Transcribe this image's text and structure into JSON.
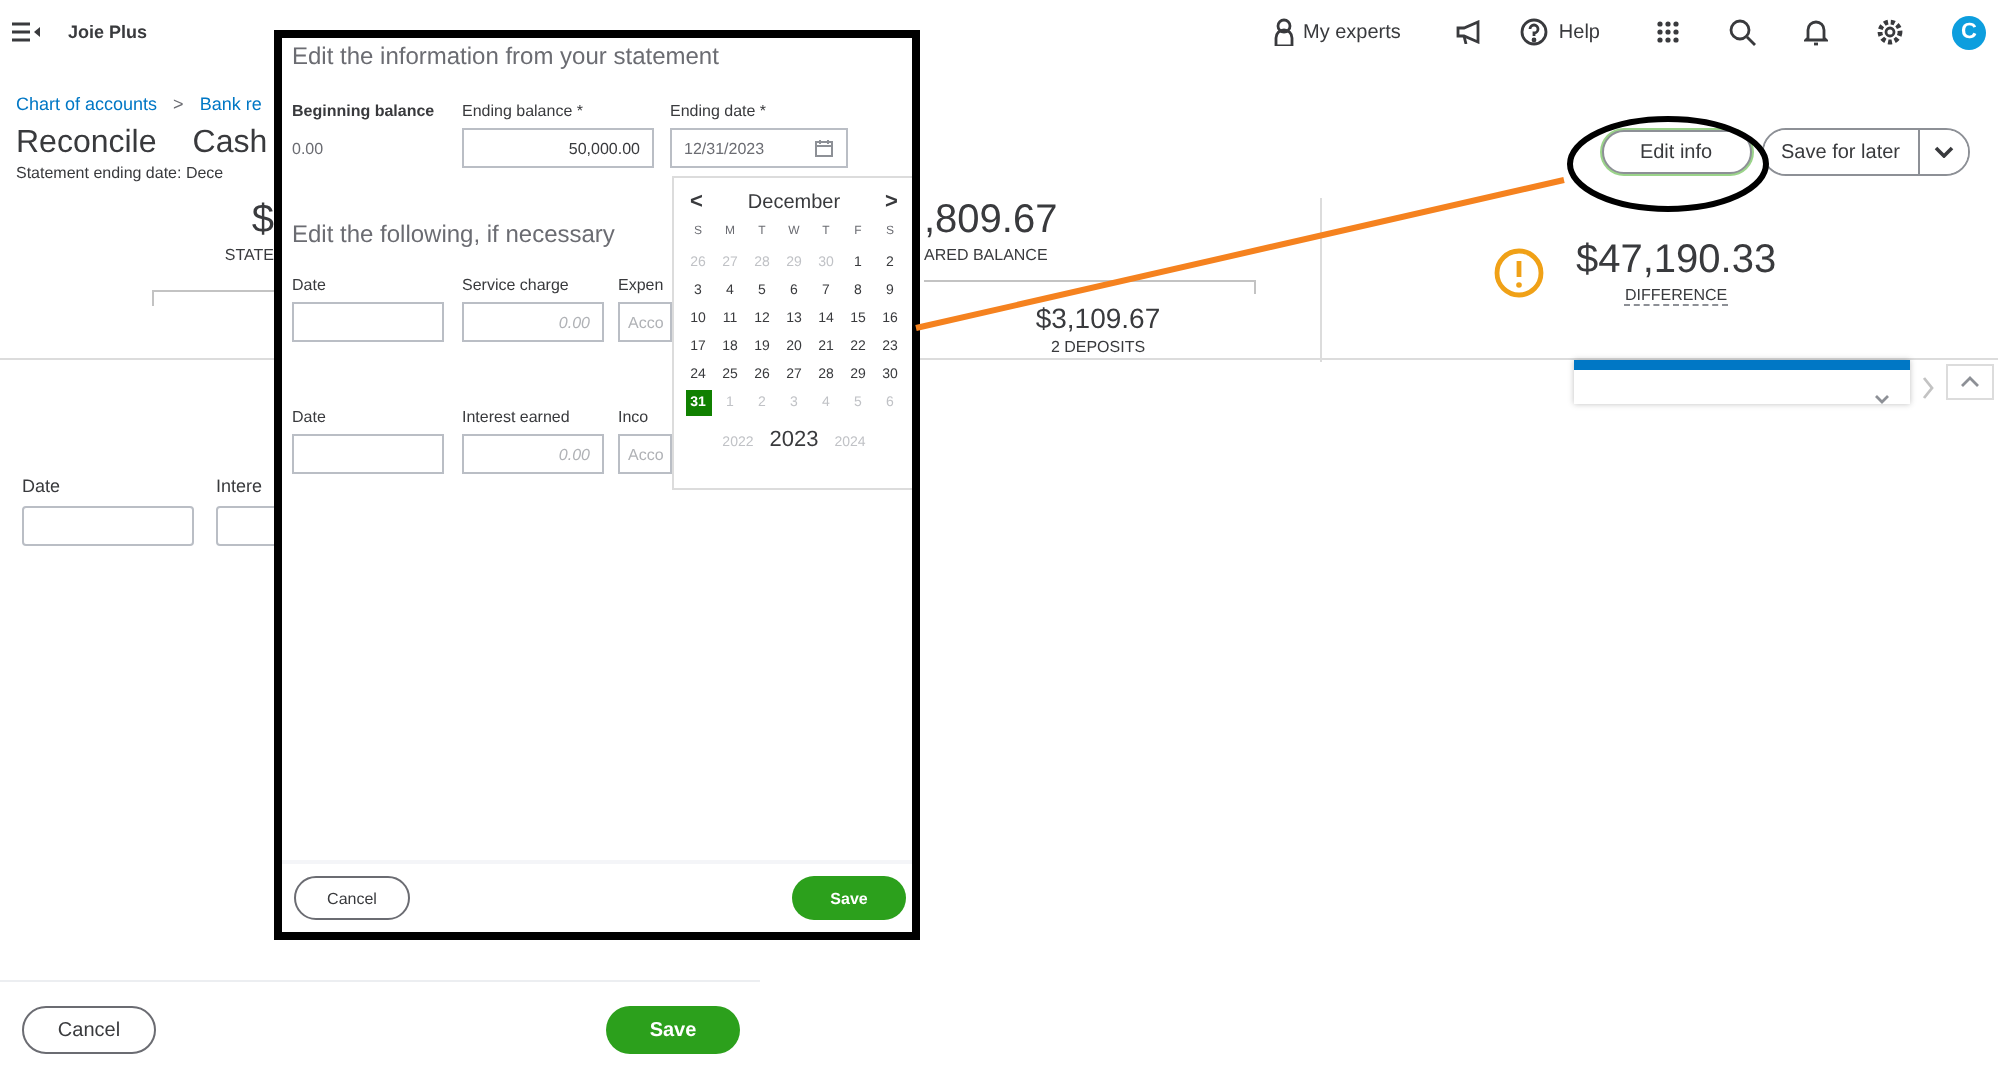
{
  "topbar": {
    "company": "Joie Plus",
    "experts_label": "My experts",
    "help_label": "Help",
    "avatar": "C"
  },
  "breadcrumb": [
    "Chart of accounts",
    ">",
    "Bank re"
  ],
  "title": "Reconcile",
  "account": "Cash",
  "statement_date": "Statement ending date: Dece",
  "header_buttons": {
    "edit": "Edit info",
    "save_later": "Save for later"
  },
  "stats": {
    "statement_amount": "$",
    "statement_label": "STATE",
    "cleared_amount": ",809.67",
    "cleared_label": "ARED BALANCE",
    "deposits_amount": "$3,109.67",
    "deposits_label": "2 DEPOSITS",
    "difference_amount": "$47,190.33",
    "difference_label": "DIFFERENCE"
  },
  "form": {
    "fields": [
      {
        "label": "Date"
      },
      {
        "label": "Intere"
      }
    ]
  },
  "footer": {
    "cancel": "Cancel",
    "save": "Save"
  },
  "dialog": {
    "title": "Edit the information from your statement",
    "beginning_balance": {
      "label": "Beginning balance",
      "value": "0.00"
    },
    "ending_balance": {
      "label": "Ending balance *",
      "value": "50,000.00"
    },
    "ending_date": {
      "label": "Ending date *",
      "value": "12/31/2023"
    },
    "section": "Edit the following, if necessary",
    "rows": [
      {
        "date_label": "Date",
        "amount_label": "Service charge",
        "amount_placeholder": "0.00",
        "account_label": "Expen",
        "account_placeholder": "Acco"
      },
      {
        "date_label": "Date",
        "amount_label": "Interest earned",
        "amount_placeholder": "0.00",
        "account_label": "Inco",
        "account_placeholder": "Acco"
      }
    ],
    "calendar": {
      "month": "December",
      "prev": "<",
      "next": ">",
      "weekdays": [
        "S",
        "M",
        "T",
        "W",
        "T",
        "F",
        "S"
      ],
      "days": [
        {
          "label": "26",
          "outside": true,
          "selected": false
        },
        {
          "label": "27",
          "outside": true,
          "selected": false
        },
        {
          "label": "28",
          "outside": true,
          "selected": false
        },
        {
          "label": "29",
          "outside": true,
          "selected": false
        },
        {
          "label": "30",
          "outside": true,
          "selected": false
        },
        {
          "label": "1",
          "outside": false,
          "selected": false
        },
        {
          "label": "2",
          "outside": false,
          "selected": false
        },
        {
          "label": "3",
          "outside": false,
          "selected": false
        },
        {
          "label": "4",
          "outside": false,
          "selected": false
        },
        {
          "label": "5",
          "outside": false,
          "selected": false
        },
        {
          "label": "6",
          "outside": false,
          "selected": false
        },
        {
          "label": "7",
          "outside": false,
          "selected": false
        },
        {
          "label": "8",
          "outside": false,
          "selected": false
        },
        {
          "label": "9",
          "outside": false,
          "selected": false
        },
        {
          "label": "10",
          "outside": false,
          "selected": false
        },
        {
          "label": "11",
          "outside": false,
          "selected": false
        },
        {
          "label": "12",
          "outside": false,
          "selected": false
        },
        {
          "label": "13",
          "outside": false,
          "selected": false
        },
        {
          "label": "14",
          "outside": false,
          "selected": false
        },
        {
          "label": "15",
          "outside": false,
          "selected": false
        },
        {
          "label": "16",
          "outside": false,
          "selected": false
        },
        {
          "label": "17",
          "outside": false,
          "selected": false
        },
        {
          "label": "18",
          "outside": false,
          "selected": false
        },
        {
          "label": "19",
          "outside": false,
          "selected": false
        },
        {
          "label": "20",
          "outside": false,
          "selected": false
        },
        {
          "label": "21",
          "outside": false,
          "selected": false
        },
        {
          "label": "22",
          "outside": false,
          "selected": false
        },
        {
          "label": "23",
          "outside": false,
          "selected": false
        },
        {
          "label": "24",
          "outside": false,
          "selected": false
        },
        {
          "label": "25",
          "outside": false,
          "selected": false
        },
        {
          "label": "26",
          "outside": false,
          "selected": false
        },
        {
          "label": "27",
          "outside": false,
          "selected": false
        },
        {
          "label": "28",
          "outside": false,
          "selected": false
        },
        {
          "label": "29",
          "outside": false,
          "selected": false
        },
        {
          "label": "30",
          "outside": false,
          "selected": false
        },
        {
          "label": "31",
          "outside": false,
          "selected": true
        },
        {
          "label": "1",
          "outside": true,
          "selected": false
        },
        {
          "label": "2",
          "outside": true,
          "selected": false
        },
        {
          "label": "3",
          "outside": true,
          "selected": false
        },
        {
          "label": "4",
          "outside": true,
          "selected": false
        },
        {
          "label": "5",
          "outside": true,
          "selected": false
        },
        {
          "label": "6",
          "outside": true,
          "selected": false
        }
      ],
      "years": [
        {
          "label": "2022",
          "selected": false
        },
        {
          "label": "2023",
          "selected": true
        },
        {
          "label": "2024",
          "selected": false
        }
      ]
    },
    "cancel": "Cancel",
    "save": "Save"
  }
}
